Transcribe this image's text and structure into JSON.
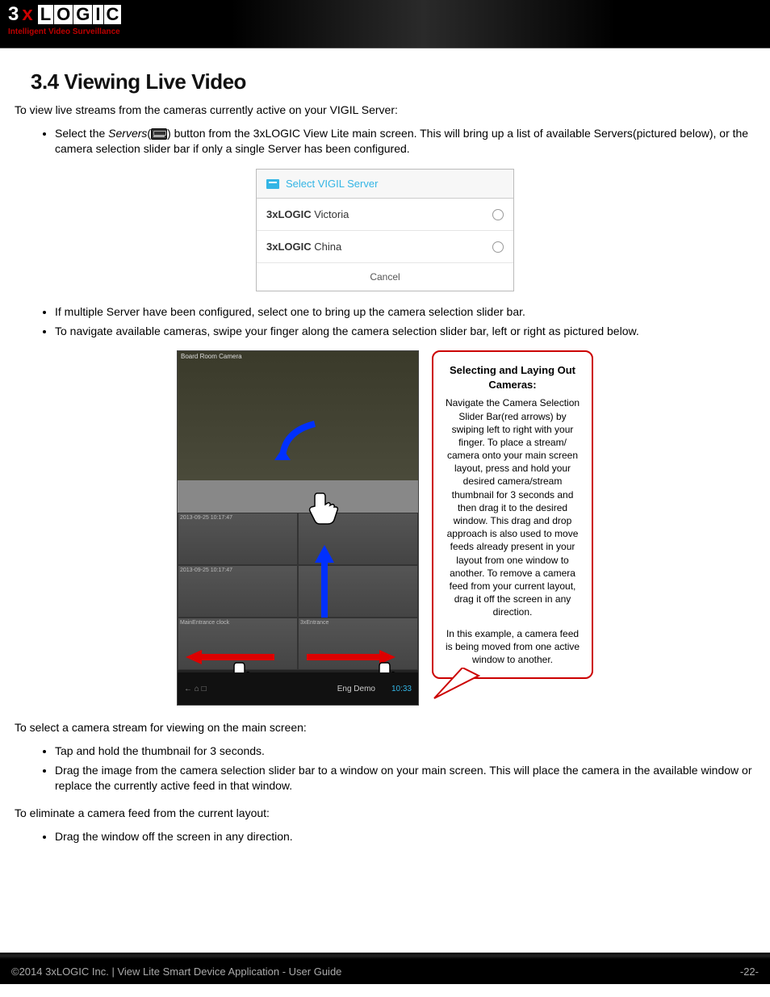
{
  "header": {
    "logo_prefix": "3",
    "logo_x": "x",
    "logo_letters": [
      "L",
      "O",
      "G",
      "I",
      "C"
    ],
    "tagline": "Intelligent Video Surveillance"
  },
  "section": {
    "title": "3.4 Viewing Live Video",
    "intro": "To view live streams from the cameras currently active on your VIGIL Server:",
    "bullet1_a": "Select the ",
    "bullet1_servers": "Servers",
    "bullet1_b": "(",
    "bullet1_c": ") button from the 3xLOGIC View Lite main screen. This will bring up a list of available Servers(pictured below), or the camera selection slider bar if only a single Server has been configured.",
    "bullet2": "If multiple Server have been configured, select one to bring up the camera selection slider bar.",
    "bullet3": "To navigate available cameras, swipe your finger along the camera selection slider bar, left or right as pictured below.",
    "para2": "To select a camera stream for viewing on the main screen:",
    "bullet4": "Tap and hold the thumbnail for 3 seconds.",
    "bullet5": "Drag the image from the camera selection slider bar to a window on your main screen. This will place the camera in the avail­able window or replace the currently active feed in that window.",
    "para3": "To eliminate a camera feed from the current layout:",
    "bullet6": "Drag the window off the screen in any direction."
  },
  "dialog": {
    "title": "Select VIGIL Server",
    "row1_bold": "3xLOGIC",
    "row1_rest": " Victoria",
    "row2_bold": "3xLOGIC",
    "row2_rest": " China",
    "cancel": "Cancel"
  },
  "phone": {
    "top_label": "Board Room Camera",
    "cells": [
      "2013-09-25 10:17:47",
      "",
      "2013-09-25 10:17:47",
      "",
      "MainEntrance clock",
      "3xEntrance",
      "",
      ""
    ],
    "bottom_nav": "←  ⌂  □",
    "bottom_site": "Eng Demo",
    "bottom_time": "10:33"
  },
  "callout": {
    "title": "Selecting and Laying Out Cameras:",
    "body1": "Navigate the Camera Selection Slider Bar(red arrows) by swiping left to right with your finger. To place a stream/ camera onto your main screen layout, press and hold your desired camera/stream thumbnail for 3 seconds and then drag it to the desired window. This drag and drop approach is also used to move feeds already present in your layout from one window to another. To remove a camera feed from your current layout, drag it off the screen in any direction.",
    "body2": "In this example, a camera feed is being moved from one active window to another."
  },
  "footer": {
    "left": "©2014 3xLOGIC Inc. | View Lite Smart Device Application - User Guide",
    "right": "-22-"
  }
}
